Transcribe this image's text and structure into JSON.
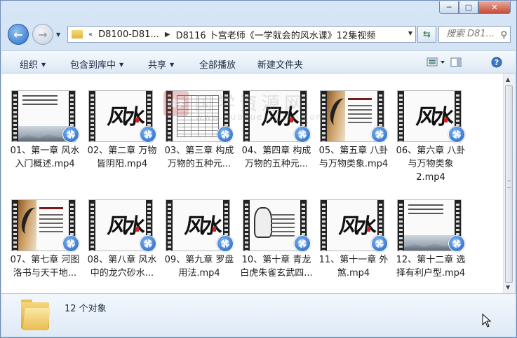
{
  "window": {
    "controls": {
      "minimize": "─",
      "maximize": "□",
      "close": "✕"
    }
  },
  "nav": {
    "back_icon": "arrow-left-icon",
    "forward_icon": "arrow-right-icon",
    "breadcrumb": [
      {
        "prefix": "«",
        "label": "D8100-D81..."
      },
      {
        "label": "D8116 卜宫老师《一学就会的风水课》12集视频"
      }
    ],
    "search_placeholder": "搜索 D81..."
  },
  "toolbar": {
    "organize": "组织",
    "include_in_library": "包含到库中",
    "share": "共享",
    "play_all": "全部播放",
    "new_folder": "新建文件夹"
  },
  "files": [
    {
      "name": "01、第一章 风水\n入门概述.mp4",
      "thumb": "text-landscape"
    },
    {
      "name": "02、第二章 万物\n皆阴阳.mp4",
      "thumb": "calligraphy"
    },
    {
      "name": "03、第三章 构成\n万物的五种元...",
      "thumb": "table"
    },
    {
      "name": "04、第四章 构成\n万物的五种元...",
      "thumb": "calligraphy"
    },
    {
      "name": "05、第五章 八卦\n与万物类象.mp4",
      "thumb": "brush-text"
    },
    {
      "name": "06、第六章 八卦\n与万物类象2.mp4",
      "thumb": "calligraphy"
    },
    {
      "name": "07、第七章 河图\n洛书与天干地...",
      "thumb": "brush-text"
    },
    {
      "name": "08、第八章 风水\n中的龙穴砂水...",
      "thumb": "calligraphy"
    },
    {
      "name": "09、第九章 罗盘\n用法.mp4",
      "thumb": "calligraphy"
    },
    {
      "name": "10、第十章 青龙\n白虎朱雀玄武四...",
      "thumb": "sage-text"
    },
    {
      "name": "11、第十一章 外\n煞.mp4",
      "thumb": "calligraphy"
    },
    {
      "name": "12、第十二章 选\n择有利户型.mp4",
      "thumb": "text-landscape"
    }
  ],
  "watermark": {
    "cn": "国学资源网",
    "url": "www.guoxueziyuan.com",
    "seal": "国学"
  },
  "status": {
    "count": "12 个对象"
  }
}
